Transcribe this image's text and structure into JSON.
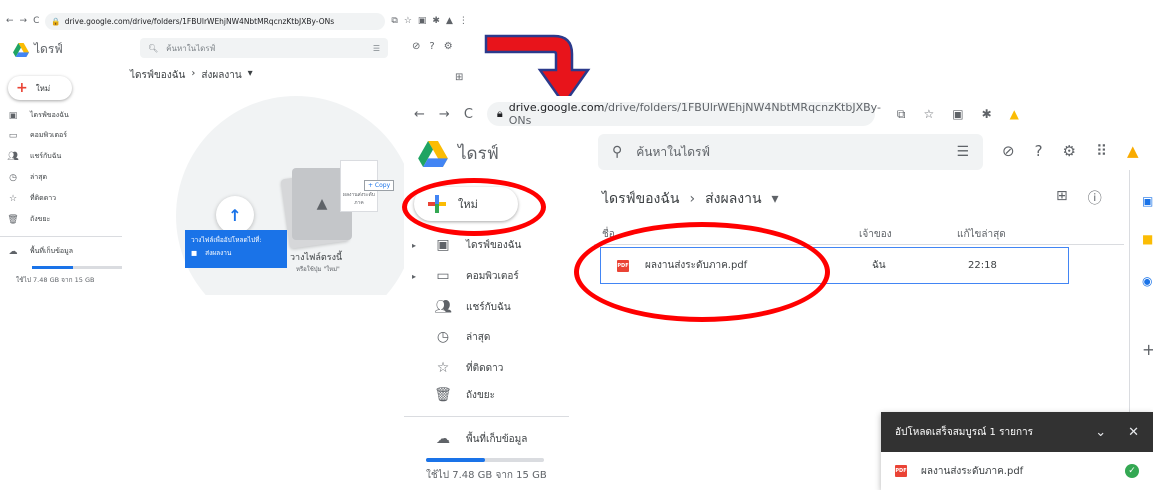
{
  "left": {
    "url": "drive.google.com/drive/folders/1FBUlrWEhjNW4NbtMRqcnzKtbJXBy-ONs",
    "app_name": "ไดรฟ์",
    "search_placeholder": "ค้นหาในไดรฟ์",
    "new_label": "ใหม่",
    "breadcrumb_root": "ไดรฟ์ของฉัน",
    "breadcrumb_current": "ส่งผลงาน",
    "nav": [
      "ไดรฟ์ของฉัน",
      "คอมพิวเตอร์",
      "แชร์กับฉัน",
      "ล่าสุด",
      "ที่ติดดาว",
      "ถังขยะ"
    ],
    "storage_label": "พื้นที่เก็บข้อมูล",
    "storage_used": "ใช้ไป 7.48 GB จาก 15 GB",
    "drop_hint": "วางไฟล์เพื่ออัปโหลดไปที่:",
    "drop_folder": "ส่งผลงาน",
    "drop_here": "วางไฟล์ตรงนี้",
    "drop_sub": "หรือใช้ปุ่ม \"ใหม่\"",
    "ghost_file": "ผลงานส่งระดับภาค",
    "copy_label": "+ Copy"
  },
  "right": {
    "url_host": "drive.google.com",
    "url_path": "/drive/folders/1FBUlrWEhjNW4NbtMRqcnzKtbJXBy-ONs",
    "app_name": "ไดรฟ์",
    "search_placeholder": "ค้นหาในไดรฟ์",
    "new_label": "ใหม่",
    "breadcrumb_root": "ไดรฟ์ของฉัน",
    "breadcrumb_current": "ส่งผลงาน",
    "nav": [
      "ไดรฟ์ของฉัน",
      "คอมพิวเตอร์",
      "แชร์กับฉัน",
      "ล่าสุด",
      "ที่ติดดาว",
      "ถังขยะ"
    ],
    "storage_label": "พื้นที่เก็บข้อมูล",
    "storage_used": "ใช้ไป 7.48 GB จาก 15 GB",
    "col_name": "ชื่อ",
    "col_owner": "เจ้าของ",
    "col_modified": "แก้ไขล่าสุด",
    "file": {
      "name": "ผลงานส่งระดับภาค.pdf",
      "owner": "ฉัน",
      "modified": "22:18"
    },
    "upload_title": "อัปโหลดเสร็จสมบูรณ์ 1 รายการ",
    "upload_file": "ผลงานส่งระดับภาค.pdf"
  },
  "colors": {
    "accent": "#1a73e8",
    "annotation": "#ff0000",
    "arrow_fill": "#e8141b",
    "arrow_outline": "#2b3a8c"
  }
}
